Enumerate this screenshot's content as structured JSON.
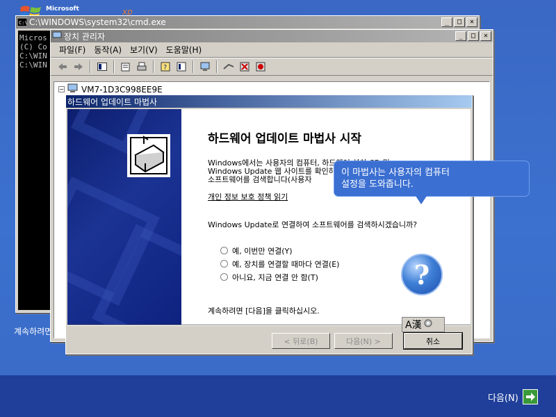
{
  "setup": {
    "logo_brand": "Microsoft",
    "logo_suffix": "xp",
    "footer_left": "계속하려면",
    "next_label": "다음(N)",
    "next_icon": "arrow-right-icon"
  },
  "cmd": {
    "title": "C:\\WINDOWS\\system32\\cmd.exe",
    "lines": [
      "Micros",
      "(C) Co",
      "",
      "C:\\WIN",
      "",
      "C:\\WIN"
    ]
  },
  "devmgr": {
    "title": "장치 관리자",
    "menu": [
      "파일(F)",
      "동작(A)",
      "보기(V)",
      "도움말(H)"
    ],
    "tree_root": "VM7-1D3C998EE9E"
  },
  "wizard": {
    "title": "하드웨어 업데이트 마법사",
    "heading": "하드웨어 업데이트 마법사 시작",
    "para_1": "Windows에서는 사용자의 컴퓨터, 하드웨어 설치 CD 및",
    "para_2": "Windows Update 웹 사이트를 확인하여 업데이트된 최신",
    "para_3": "소프트웨어를 검색합니다(사용자",
    "privacy_link": "개인 정보 보호 정책 읽기",
    "question": "Windows Update로 연결하여 소프트웨어를 검색하시겠습니까?",
    "options": [
      "예, 이번만 연결(Y)",
      "예, 장치를 연결할 때마다 연결(E)",
      "아니요, 지금 연결 안 함(T)"
    ],
    "continue_text": "계속하려면 [다음]을 클릭하십시오.",
    "back_label": "< 뒤로(B)",
    "next_label": "다음(N) >",
    "cancel_label": "취소"
  },
  "balloon": {
    "line_1": "이 마법사는 사용자의 컴퓨터",
    "line_2": "설정을 도와줍니다."
  },
  "ime": {
    "label": "A漢"
  },
  "colors": {
    "setup_blue": "#3a6ec9",
    "balloon_blue": "#3b6fd1",
    "active_title": "#0a246a"
  }
}
